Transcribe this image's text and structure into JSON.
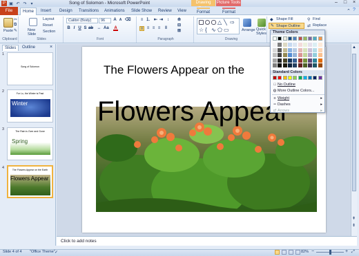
{
  "title_bar": {
    "title": "Song of Solomon - Microsoft PowerPoint",
    "context_drawing": "Drawing Tools",
    "context_picture": "Picture Tools",
    "qat_icons": [
      "save-icon",
      "undo-icon",
      "redo-icon",
      "customize-icon"
    ]
  },
  "tabs": {
    "file": "File",
    "items": [
      "Home",
      "Insert",
      "Design",
      "Transitions",
      "Animations",
      "Slide Show",
      "Review",
      "View",
      "Format",
      "Format"
    ],
    "active": "Home"
  },
  "ribbon": {
    "clipboard": {
      "paste": "Paste",
      "label": "Clipboard"
    },
    "slides": {
      "new_slide": "New Slide",
      "layout": "Layout",
      "reset": "Reset",
      "section": "Section",
      "label": "Slides"
    },
    "font": {
      "family": "Calibri (Body)",
      "size": "96",
      "label": "Font"
    },
    "paragraph": {
      "label": "Paragraph"
    },
    "drawing": {
      "label": "Drawing",
      "arrange": "Arrange",
      "quick_styles": "Quick Styles",
      "shape_fill": "Shape Fill",
      "shape_outline": "Shape Outline"
    },
    "editing": {
      "find": "Find",
      "replace": "Replace"
    }
  },
  "panel": {
    "tab_slides": "Slides",
    "tab_outline": "Outline",
    "thumbs": [
      {
        "num": "1",
        "title": "Song of Solomon",
        "art": ""
      },
      {
        "num": "2",
        "title": "For Lo, the Winter is Past",
        "art": "Winter"
      },
      {
        "num": "3",
        "title": "The Rain is Over and Gone",
        "art": "Spring"
      },
      {
        "num": "4",
        "title": "The Flowers Appear on the Earth",
        "art": "Flowers Appear"
      }
    ]
  },
  "slide": {
    "title": "The Flowers Appear on the",
    "wordart": "Flowers Appear",
    "notes_placeholder": "Click to add notes"
  },
  "status": {
    "slide_info": "Slide 4 of 4",
    "theme": "\"Office Theme\"",
    "zoom": "82%"
  },
  "outline_menu": {
    "theme_colors_label": "Theme Colors",
    "standard_colors_label": "Standard Colors",
    "theme_top_row": [
      "#ffffff",
      "#000000",
      "#eeece1",
      "#1f497d",
      "#4f81bd",
      "#c0504d",
      "#9bbb59",
      "#8064a2",
      "#4bacc6",
      "#f79646"
    ],
    "theme_shade_cols": [
      [
        "#f2f2f2",
        "#d9d9d9",
        "#bfbfbf",
        "#a6a6a6",
        "#7f7f7f"
      ],
      [
        "#7f7f7f",
        "#595959",
        "#404040",
        "#262626",
        "#0d0d0d"
      ],
      [
        "#ddd9c3",
        "#c4bd97",
        "#938953",
        "#494429",
        "#1d1b10"
      ],
      [
        "#c6d9f0",
        "#8db3e2",
        "#548dd4",
        "#17365d",
        "#0f243e"
      ],
      [
        "#dbe5f1",
        "#b8cce4",
        "#95b3d7",
        "#366092",
        "#244061"
      ],
      [
        "#f2dcdb",
        "#e5b9b7",
        "#d99694",
        "#953734",
        "#632423"
      ],
      [
        "#ebf1dd",
        "#d7e3bc",
        "#c3d69b",
        "#76923c",
        "#4f6128"
      ],
      [
        "#e5e0ec",
        "#ccc1d9",
        "#b2a2c7",
        "#5f497a",
        "#3f3151"
      ],
      [
        "#dbeef3",
        "#b7dde8",
        "#92cddc",
        "#31859b",
        "#205867"
      ],
      [
        "#fdeada",
        "#fbd5b5",
        "#fac08f",
        "#e36c09",
        "#974806"
      ]
    ],
    "standard": [
      "#c00000",
      "#ff0000",
      "#ffc000",
      "#ffff00",
      "#92d050",
      "#00b050",
      "#00b0f0",
      "#0070c0",
      "#002060",
      "#7030a0"
    ],
    "items": {
      "no_outline": "No Outline",
      "more_colors": "More Outline Colors...",
      "weight": "Weight",
      "dashes": "Dashes",
      "arrows": "Arrows"
    }
  }
}
